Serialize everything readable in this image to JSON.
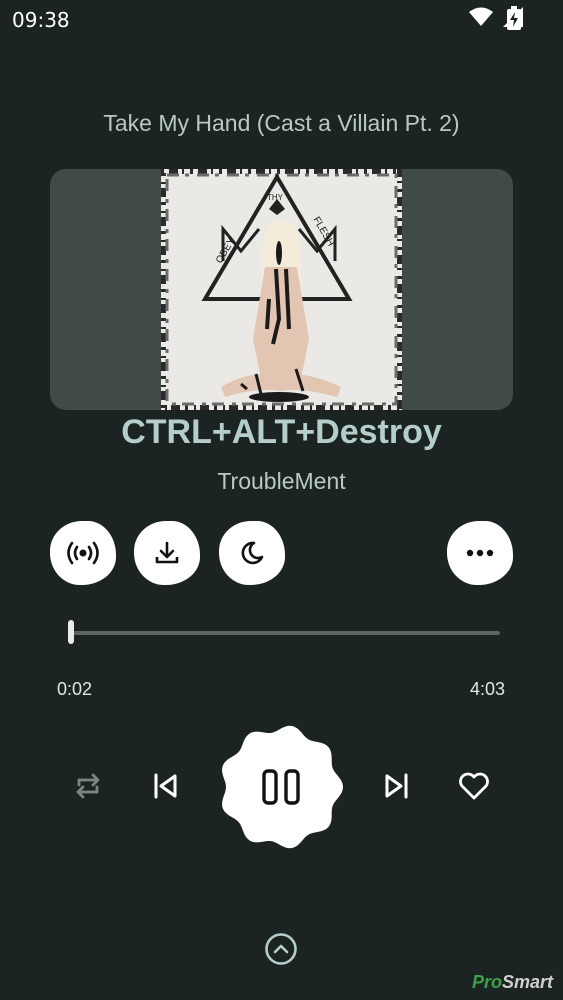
{
  "status_bar": {
    "time": "09:38"
  },
  "player": {
    "album_title": "Take My Hand (Cast a Villain Pt. 2)",
    "song_title": "CTRL+ALT+Destroy",
    "artist": "TroubleMent",
    "elapsed": "0:02",
    "total": "4:03",
    "progress_fraction": 0.008
  },
  "art": {
    "word_left": "OBEY",
    "word_top": "THY",
    "word_right": "FLESH"
  },
  "action_buttons": [
    {
      "name": "broadcast-icon"
    },
    {
      "name": "download-icon"
    },
    {
      "name": "sleep-timer-moon-icon"
    },
    {
      "name": "more-options-icon"
    }
  ],
  "controls": [
    "repeat-icon",
    "previous-icon",
    "pause-icon",
    "next-icon",
    "heart-icon"
  ],
  "watermark": {
    "pro": "Pro",
    "smart": "Smart"
  },
  "colors": {
    "background": "#1c2423",
    "accent": "#b4cfc9",
    "watermark_green": "#3aa34a"
  }
}
